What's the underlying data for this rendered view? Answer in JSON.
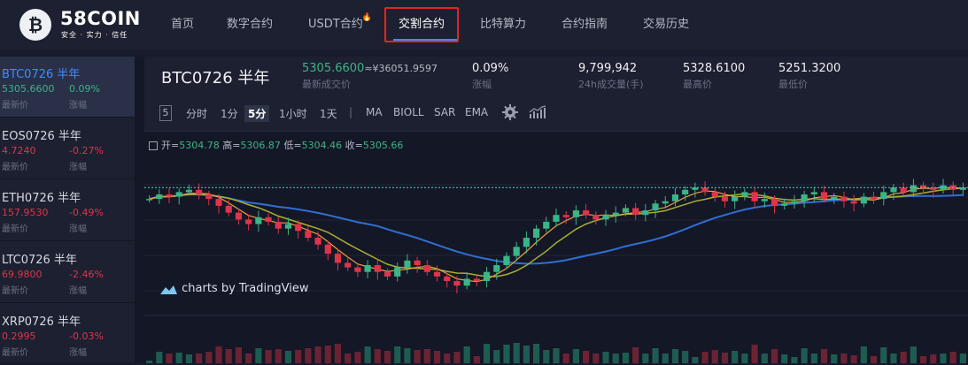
{
  "brand": {
    "name": "58COIN",
    "tagline": "安全 · 实力 · 信任",
    "logo_glyph": "₿"
  },
  "nav": [
    {
      "label": "首页"
    },
    {
      "label": "数字合约"
    },
    {
      "label": "USDT合约",
      "badge_icon": "flame-icon"
    },
    {
      "label": "交割合约",
      "active": true
    },
    {
      "label": "比特算力"
    },
    {
      "label": "合约指南"
    },
    {
      "label": "交易历史"
    }
  ],
  "sidebar": {
    "items": [
      {
        "name": "BTC0726 半年",
        "price": "5305.6600",
        "change": "0.09%",
        "price_label": "最新价",
        "change_label": "涨幅",
        "trend": "up",
        "active": true
      },
      {
        "name": "EOS0726 半年",
        "price": "4.7240",
        "change": "-0.27%",
        "price_label": "最新价",
        "change_label": "涨幅",
        "trend": "down"
      },
      {
        "name": "ETH0726 半年",
        "price": "157.9530",
        "change": "-0.49%",
        "price_label": "最新价",
        "change_label": "涨幅",
        "trend": "down"
      },
      {
        "name": "LTC0726 半年",
        "price": "69.9800",
        "change": "-2.46%",
        "price_label": "最新价",
        "change_label": "涨幅",
        "trend": "down"
      },
      {
        "name": "XRP0726 半年",
        "price": "0.2995",
        "change": "-0.03%",
        "price_label": "最新价",
        "change_label": "涨幅",
        "trend": "down"
      }
    ]
  },
  "ticker": {
    "symbol": "BTC0726 半年",
    "last_price": "5305.6600",
    "last_price_cny": "≈¥36051.9597",
    "last_price_label": "最新成交价",
    "change": "0.09%",
    "change_label": "涨幅",
    "volume": "9,799,942",
    "volume_label": "24h成交量(手)",
    "high": "5328.6100",
    "high_label": "最高价",
    "low": "5251.3200",
    "low_label": "最低价"
  },
  "toolbar": {
    "interval_box": "5",
    "intervals": [
      "分时",
      "1分",
      "5分",
      "1小时",
      "1天"
    ],
    "selected_interval": "5分",
    "separator": "|",
    "indicators": [
      "MA",
      "BIOLL",
      "SAR",
      "EMA"
    ],
    "icons": [
      "gear-icon",
      "indicator-chart-icon"
    ]
  },
  "chart": {
    "ohlc_labels": {
      "open": "开=",
      "high": "高=",
      "low": "低=",
      "close": "收="
    },
    "ohlc_values": {
      "open": "5304.78",
      "high": "5306.87",
      "low": "5304.46",
      "close": "5305.66"
    },
    "attribution": "charts by TradingView",
    "colors": {
      "up": "#3bb487",
      "down": "#e0344b",
      "ma_long": "#2f6fd6",
      "ma_mid": "#a8b030",
      "ma_short": "#e8a33a",
      "last_price_line": "#4fd8c8"
    },
    "close_series": [
      5300,
      5302,
      5301,
      5303,
      5304,
      5302,
      5300,
      5297,
      5294,
      5291,
      5289,
      5292,
      5290,
      5287,
      5289,
      5286,
      5283,
      5280,
      5276,
      5272,
      5270,
      5268,
      5271,
      5268,
      5266,
      5270,
      5273,
      5271,
      5268,
      5266,
      5264,
      5262,
      5265,
      5264,
      5268,
      5271,
      5275,
      5279,
      5283,
      5287,
      5290,
      5293,
      5292,
      5295,
      5293,
      5291,
      5293,
      5294,
      5296,
      5293,
      5295,
      5298,
      5299,
      5302,
      5304,
      5305,
      5303,
      5301,
      5299,
      5301,
      5303,
      5299,
      5300,
      5297,
      5298,
      5299,
      5302,
      5303,
      5300,
      5301,
      5299,
      5298,
      5301,
      5300,
      5303,
      5305,
      5303,
      5306,
      5305,
      5304,
      5306,
      5304,
      5305
    ]
  }
}
